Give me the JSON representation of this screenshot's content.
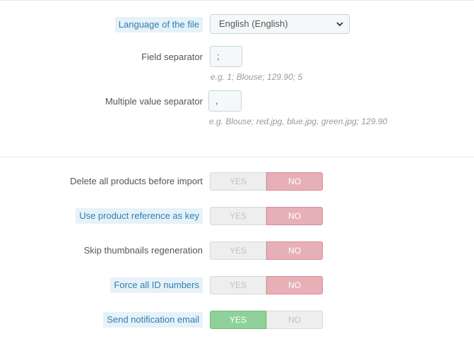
{
  "language": {
    "label": "Language of the file",
    "value": "English (English)"
  },
  "field_separator": {
    "label": "Field separator",
    "value": ";",
    "hint": "e.g. 1; Blouse; 129.90; 5"
  },
  "multiple_value_separator": {
    "label": "Multiple value separator",
    "value": ",",
    "hint": "e.g. Blouse; red.jpg, blue.jpg, green.jpg; 129.90"
  },
  "switch_labels": {
    "yes": "YES",
    "no": "NO"
  },
  "toggles": [
    {
      "label": "Delete all products before import",
      "state": "NO"
    },
    {
      "label": "Use product reference as key",
      "state": "NO"
    },
    {
      "label": "Skip thumbnails regeneration",
      "state": "NO"
    },
    {
      "label": "Force all ID numbers",
      "state": "NO"
    },
    {
      "label": "Send notification email",
      "state": "YES"
    }
  ],
  "colors": {
    "no_active": "#e7b0b6",
    "yes_active": "#8fd19a",
    "tooltip_label_bg": "#e6f1f8",
    "tooltip_label_text": "#2f7fb1"
  }
}
